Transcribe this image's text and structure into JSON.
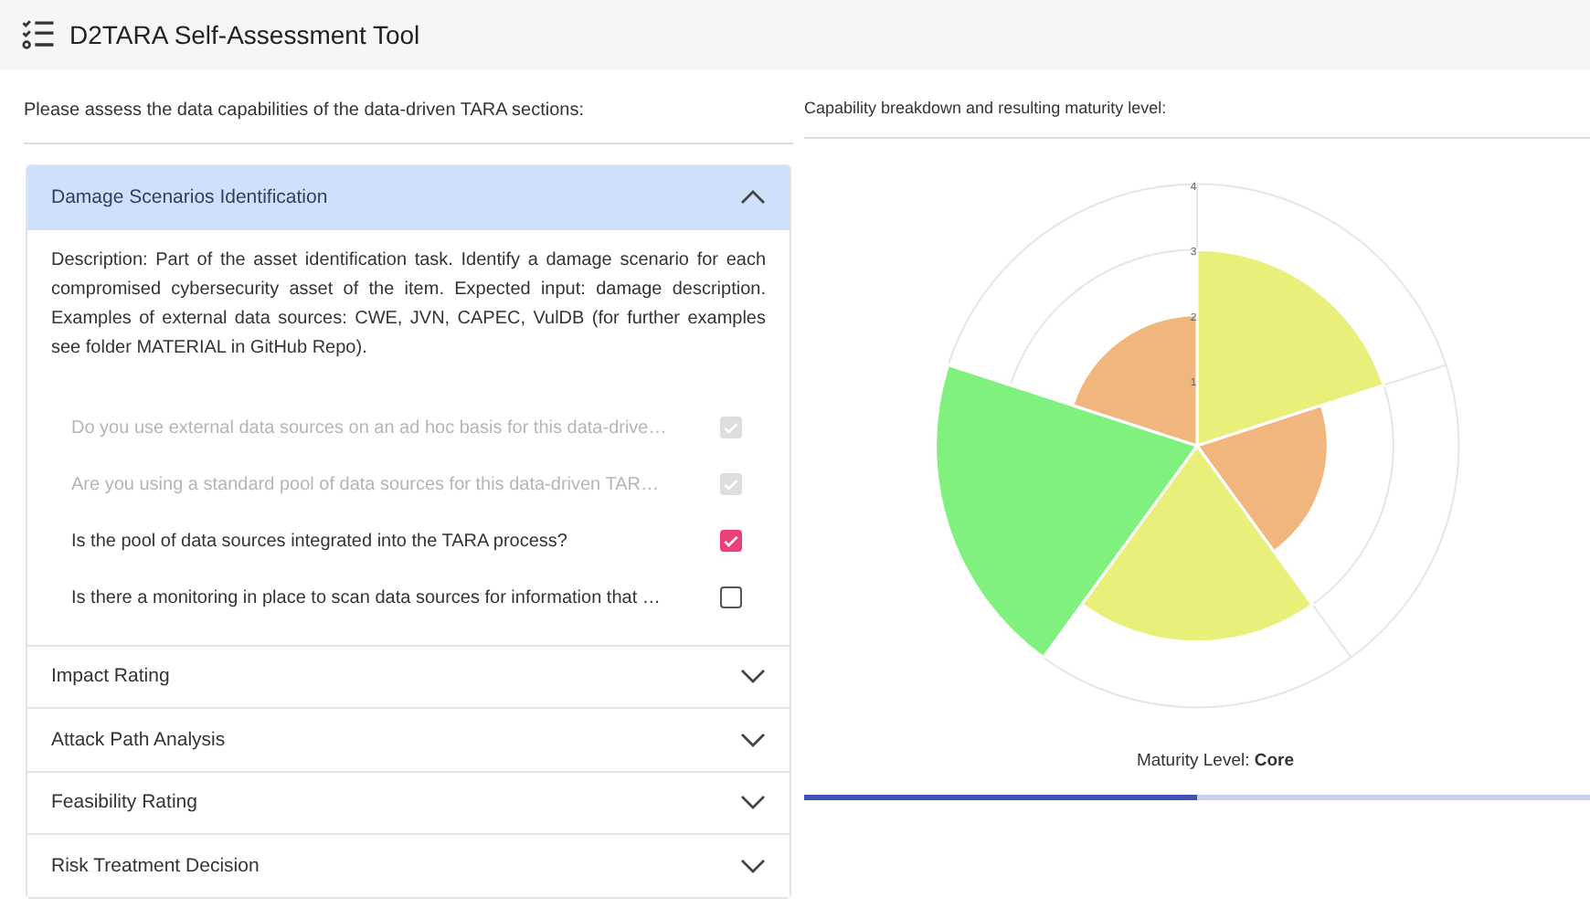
{
  "app_bar": {
    "title": "D2TARA Self-Assessment Tool"
  },
  "left": {
    "prompt": "Please assess the data capabilities of the data-driven TARA sections:",
    "sections": [
      {
        "title": "Damage Scenarios Identification",
        "expanded": true,
        "description": "Description: Part of the asset identification task. Identify a damage scenario for each compromised cybersecurity asset of the item. Expected input: damage description. Examples of external data sources: CWE, JVN, CAPEC, VulDB (for further examples see folder MATERIAL in GitHub Repo).",
        "questions": [
          {
            "text": "Do you use external data sources on an ad hoc basis for this data-drive…",
            "checked": true,
            "disabled": true
          },
          {
            "text": "Are you using a standard pool of data sources for this data-driven TAR…",
            "checked": true,
            "disabled": true
          },
          {
            "text": "Is the pool of data sources integrated into the TARA process?",
            "checked": true,
            "disabled": false
          },
          {
            "text": "Is there a monitoring in place to scan data sources for information that …",
            "checked": false,
            "disabled": false
          }
        ]
      },
      {
        "title": "Impact Rating",
        "expanded": false
      },
      {
        "title": "Attack Path Analysis",
        "expanded": false
      },
      {
        "title": "Feasibility Rating",
        "expanded": false
      },
      {
        "title": "Risk Treatment Decision",
        "expanded": false
      }
    ]
  },
  "right": {
    "heading": "Capability breakdown and resulting maturity level:",
    "ring_labels": [
      "4",
      "3",
      "2",
      "1"
    ],
    "maturity_label": "Maturity Level:",
    "maturity_value": "Core",
    "progress": {
      "level": 0.5
    }
  }
}
